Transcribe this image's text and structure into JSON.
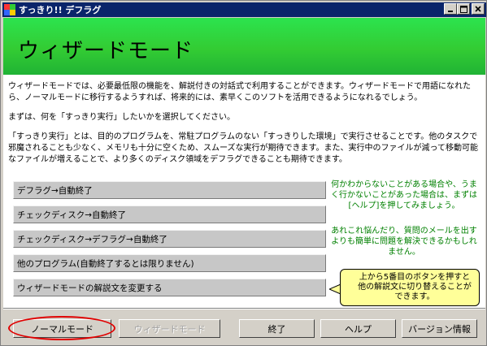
{
  "window": {
    "title": "すっきり!! デフラグ",
    "controls": [
      "minimize-icon",
      "maximize-icon",
      "close-icon"
    ]
  },
  "banner": {
    "title": "ウィザードモード"
  },
  "intro": {
    "p1": "ウィザードモードでは、必要最低限の機能を、解説付きの対話式で利用することができます。ウィザードモードで用語になれたら、ノーマルモードに移行するようすれば、将来的には、素早くこのソフトを活用できるようになれるでしょう。",
    "p2": "まずは、何を「すっきり実行」したいかを選択してください。",
    "p3": "「すっきり実行」とは、目的のプログラムを、常駐プログラムのない「すっきりした環境」で実行させることです。他のタスクで邪魔されることも少なく、メモリも十分に空くため、スムーズな実行が期待できます。また、実行中のファイルが減って移動可能なファイルが増えることで、より多くのディスク領域をデフラグできることも期待できます。"
  },
  "wizard_buttons": [
    "デフラグ→自動終了",
    "チェックディスク→自動終了",
    "チェックディスク→デフラグ→自動終了",
    "他のプログラム(自動終了するとは限りません)",
    "ウィザードモードの解説文を変更する"
  ],
  "help": {
    "text1": "何かわからないことがある場合や、うまく行かないことがあった場合は、まずは[ヘルプ]を押してみましょう。",
    "text2": "あれこれ悩んだり、質問のメールを出すよりも簡単に問題を解決できるかもしれません。"
  },
  "callout": {
    "text": "上から5番目のボタンを押すと他の解説文に切り替えることができます。"
  },
  "bottom_buttons": {
    "normal_mode": "ノーマルモード",
    "wizard_mode": "ウィザードモード",
    "exit": "終了",
    "help": "ヘルプ",
    "version": "バージョン情報"
  },
  "colors": {
    "titlebar": "#0a246a",
    "banner_green": "#33cc33",
    "help_text": "#008000",
    "callout_bg": "#ffff99",
    "highlight_oval": "#e00000"
  }
}
